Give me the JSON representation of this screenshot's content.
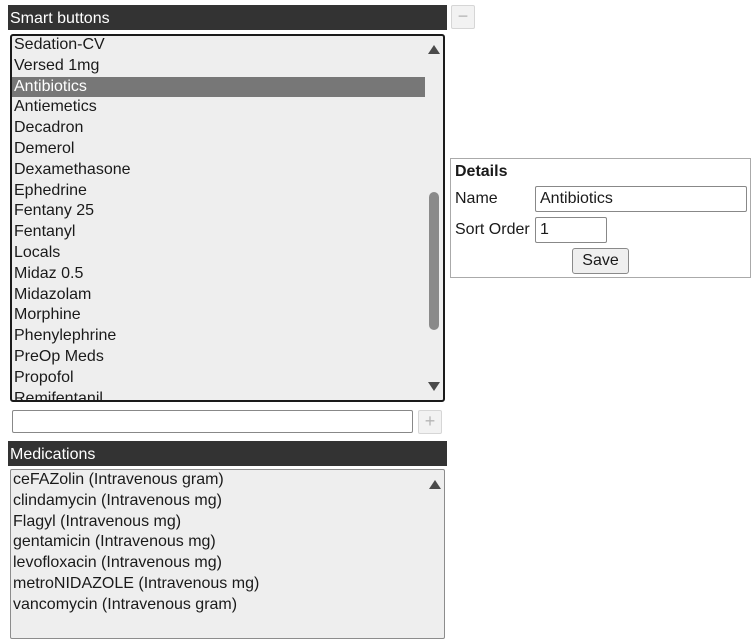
{
  "smart_buttons": {
    "header": "Smart buttons",
    "remove_label": "−",
    "add_label": "+",
    "new_item_value": "",
    "items": [
      {
        "label": "Sedation-CV"
      },
      {
        "label": "Versed 1mg"
      },
      {
        "label": "Antibiotics",
        "selected": true
      },
      {
        "label": "Antiemetics"
      },
      {
        "label": "Decadron"
      },
      {
        "label": "Demerol"
      },
      {
        "label": "Dexamethasone"
      },
      {
        "label": "Ephedrine"
      },
      {
        "label": "Fentany 25"
      },
      {
        "label": "Fentanyl"
      },
      {
        "label": "Locals"
      },
      {
        "label": "Midaz 0.5"
      },
      {
        "label": "Midazolam"
      },
      {
        "label": "Morphine"
      },
      {
        "label": "Phenylephrine"
      },
      {
        "label": "PreOp Meds"
      },
      {
        "label": "Propofol"
      },
      {
        "label": "Remifentanil"
      }
    ]
  },
  "details": {
    "title": "Details",
    "name_label": "Name",
    "name_value": "Antibiotics",
    "sort_label": "Sort Order",
    "sort_value": "1",
    "save_label": "Save"
  },
  "medications": {
    "header": "Medications",
    "items": [
      {
        "label": "ceFAZolin (Intravenous gram)"
      },
      {
        "label": "clindamycin (Intravenous mg)"
      },
      {
        "label": "Flagyl (Intravenous mg)"
      },
      {
        "label": "gentamicin (Intravenous mg)"
      },
      {
        "label": "levofloxacin (Intravenous mg)"
      },
      {
        "label": "metroNIDAZOLE (Intravenous mg)"
      },
      {
        "label": "vancomycin (Intravenous gram)"
      }
    ]
  },
  "icons": {
    "scroll_up": "triangle-up-icon",
    "scroll_down": "triangle-down-icon"
  },
  "colors": {
    "header_bg": "#333333",
    "list_bg": "#eeeeee",
    "selected_bg": "#777777"
  }
}
